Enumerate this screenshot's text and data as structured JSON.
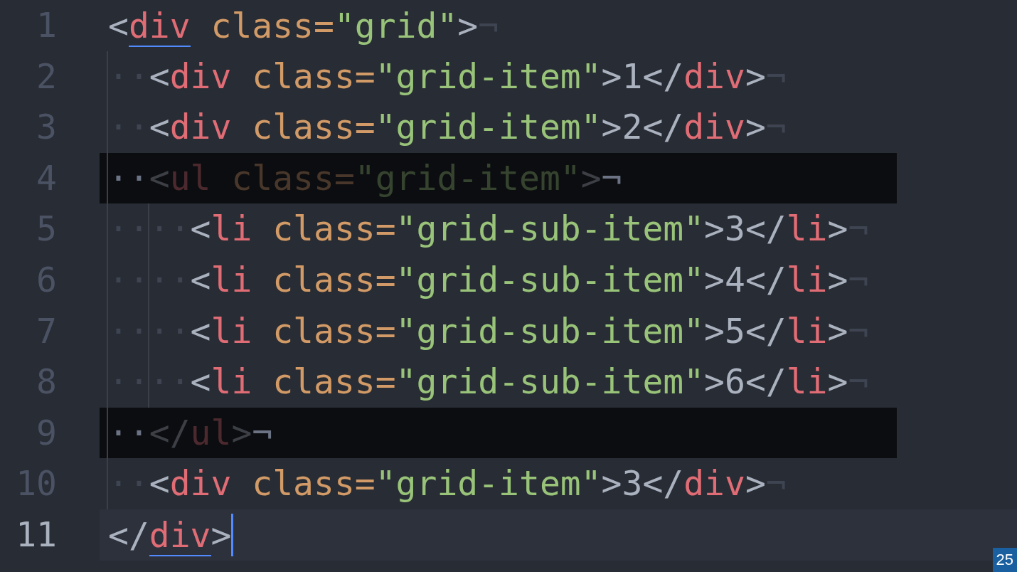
{
  "editor": {
    "lines": [
      {
        "number": "1",
        "tokens": [
          {
            "kind": "punct",
            "text": "<"
          },
          {
            "kind": "tag",
            "text": "div",
            "matched": true
          },
          {
            "kind": "attr",
            "text": " class="
          },
          {
            "kind": "string",
            "text": "\"grid\""
          },
          {
            "kind": "punct",
            "text": ">"
          }
        ],
        "eol": "¬",
        "dimmed": false,
        "current": false
      },
      {
        "number": "2",
        "indent": "··",
        "tokens": [
          {
            "kind": "punct",
            "text": "<"
          },
          {
            "kind": "tag",
            "text": "div"
          },
          {
            "kind": "attr",
            "text": " class="
          },
          {
            "kind": "string",
            "text": "\"grid-item\""
          },
          {
            "kind": "punct",
            "text": ">1</"
          },
          {
            "kind": "tag",
            "text": "div"
          },
          {
            "kind": "punct",
            "text": ">"
          }
        ],
        "eol": "¬",
        "dimmed": false,
        "current": false
      },
      {
        "number": "3",
        "indent": "··",
        "tokens": [
          {
            "kind": "punct",
            "text": "<"
          },
          {
            "kind": "tag",
            "text": "div"
          },
          {
            "kind": "attr",
            "text": " class="
          },
          {
            "kind": "string",
            "text": "\"grid-item\""
          },
          {
            "kind": "punct",
            "text": ">2</"
          },
          {
            "kind": "tag",
            "text": "div"
          },
          {
            "kind": "punct",
            "text": ">"
          }
        ],
        "eol": "¬",
        "dimmed": false,
        "current": false
      },
      {
        "number": "4",
        "indent": "··",
        "tokens": [
          {
            "kind": "punct",
            "text": "<"
          },
          {
            "kind": "tag",
            "text": "ul"
          },
          {
            "kind": "attr",
            "text": " class="
          },
          {
            "kind": "string",
            "text": "\"grid-item\""
          },
          {
            "kind": "punct",
            "text": ">"
          }
        ],
        "eol": "¬",
        "dimmed": true,
        "current": false
      },
      {
        "number": "5",
        "indent": "····",
        "tokens": [
          {
            "kind": "punct",
            "text": "<"
          },
          {
            "kind": "tag",
            "text": "li"
          },
          {
            "kind": "attr",
            "text": " class="
          },
          {
            "kind": "string",
            "text": "\"grid-sub-item\""
          },
          {
            "kind": "punct",
            "text": ">3</"
          },
          {
            "kind": "tag",
            "text": "li"
          },
          {
            "kind": "punct",
            "text": ">"
          }
        ],
        "eol": "¬",
        "dimmed": false,
        "current": false
      },
      {
        "number": "6",
        "indent": "····",
        "tokens": [
          {
            "kind": "punct",
            "text": "<"
          },
          {
            "kind": "tag",
            "text": "li"
          },
          {
            "kind": "attr",
            "text": " class="
          },
          {
            "kind": "string",
            "text": "\"grid-sub-item\""
          },
          {
            "kind": "punct",
            "text": ">4</"
          },
          {
            "kind": "tag",
            "text": "li"
          },
          {
            "kind": "punct",
            "text": ">"
          }
        ],
        "eol": "¬",
        "dimmed": false,
        "current": false
      },
      {
        "number": "7",
        "indent": "····",
        "tokens": [
          {
            "kind": "punct",
            "text": "<"
          },
          {
            "kind": "tag",
            "text": "li"
          },
          {
            "kind": "attr",
            "text": " class="
          },
          {
            "kind": "string",
            "text": "\"grid-sub-item\""
          },
          {
            "kind": "punct",
            "text": ">5</"
          },
          {
            "kind": "tag",
            "text": "li"
          },
          {
            "kind": "punct",
            "text": ">"
          }
        ],
        "eol": "¬",
        "dimmed": false,
        "current": false
      },
      {
        "number": "8",
        "indent": "····",
        "tokens": [
          {
            "kind": "punct",
            "text": "<"
          },
          {
            "kind": "tag",
            "text": "li"
          },
          {
            "kind": "attr",
            "text": " class="
          },
          {
            "kind": "string",
            "text": "\"grid-sub-item\""
          },
          {
            "kind": "punct",
            "text": ">6</"
          },
          {
            "kind": "tag",
            "text": "li"
          },
          {
            "kind": "punct",
            "text": ">"
          }
        ],
        "eol": "¬",
        "dimmed": false,
        "current": false
      },
      {
        "number": "9",
        "indent": "··",
        "tokens": [
          {
            "kind": "punct",
            "text": "</"
          },
          {
            "kind": "tag",
            "text": "ul"
          },
          {
            "kind": "punct",
            "text": ">"
          }
        ],
        "eol": "¬",
        "dimmed": true,
        "current": false
      },
      {
        "number": "10",
        "indent": "··",
        "tokens": [
          {
            "kind": "punct",
            "text": "<"
          },
          {
            "kind": "tag",
            "text": "div"
          },
          {
            "kind": "attr",
            "text": " class="
          },
          {
            "kind": "string",
            "text": "\"grid-item\""
          },
          {
            "kind": "punct",
            "text": ">3</"
          },
          {
            "kind": "tag",
            "text": "div"
          },
          {
            "kind": "punct",
            "text": ">"
          }
        ],
        "eol": "¬",
        "dimmed": false,
        "current": false
      },
      {
        "number": "11",
        "tokens": [
          {
            "kind": "punct",
            "text": "</"
          },
          {
            "kind": "tag",
            "text": "div",
            "matched": true
          },
          {
            "kind": "punct",
            "text": ">"
          }
        ],
        "dimmed": false,
        "current": true
      }
    ]
  },
  "badge": "25"
}
